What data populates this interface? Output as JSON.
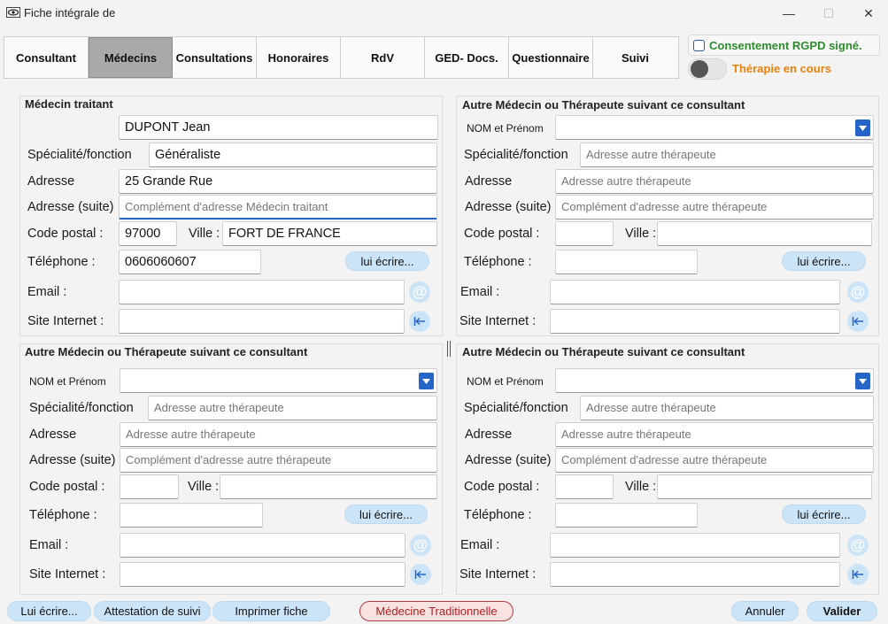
{
  "window": {
    "title": "Fiche intégrale de",
    "minimize_glyph": "—",
    "maximize_glyph": "☐",
    "close_glyph": "✕"
  },
  "tabs": [
    {
      "label": "Consultant",
      "active": false
    },
    {
      "label": "Médecins",
      "active": true
    },
    {
      "label": "Consultations",
      "active": false
    },
    {
      "label": "Honoraires",
      "active": false
    },
    {
      "label": "RdV",
      "active": false
    },
    {
      "label": "GED- Docs.",
      "active": false
    },
    {
      "label": "Questionnaire",
      "active": false
    },
    {
      "label": "Suivi",
      "active": false
    }
  ],
  "consent": {
    "label": "Consentement RGPD signé.",
    "checked": false,
    "color": "#2e8b2e"
  },
  "therapy": {
    "label": "Thérapie en cours",
    "on": false,
    "color": "#e8820c"
  },
  "treating_doctor": {
    "title": "Médecin traitant",
    "name": "DUPONT Jean",
    "specialty_label": "Spécialité/fonction",
    "specialty": "Généraliste",
    "address_label": "Adresse",
    "address": "25 Grande Rue",
    "address2_label": "Adresse (suite)",
    "address2": "",
    "address2_placeholder": "Complément d'adresse Médecin traitant",
    "postcode_label": "Code postal :",
    "postcode": "97000",
    "city_label": "Ville :",
    "city": "FORT DE FRANCE",
    "phone_label": "Téléphone :",
    "phone": "0606060607",
    "write_button": "lui écrire...",
    "email_label": "Email :",
    "email": "",
    "website_label": "Site Internet :",
    "website": ""
  },
  "other_therapist": {
    "title": "Autre Médecin ou Thérapeute suivant ce consultant",
    "name_label": "NOM et Prénom",
    "specialty_label": "Spécialité/fonction",
    "specialty_placeholder": "Adresse autre thérapeute",
    "address_label": "Adresse",
    "address_placeholder": "Adresse autre thérapeute",
    "address2_label": "Adresse (suite)",
    "address2_placeholder": "Complément d'adresse autre thérapeute",
    "postcode_label": "Code postal :",
    "city_label": "Ville :",
    "phone_label": "Téléphone :",
    "write_button": "lui écrire...",
    "email_label": "Email :",
    "website_label": "Site Internet :"
  },
  "bottom_buttons": {
    "write": "Lui écrire...",
    "attestation": "Attestation de suivi",
    "print": "Imprimer fiche",
    "traditional": "Médecine Traditionnelle",
    "cancel": "Annuler",
    "validate": "Valider"
  },
  "icons": {
    "email": "@",
    "website": "⇤"
  },
  "colors": {
    "accent": "#2465c7",
    "button_bg": "#cce4f7",
    "active_tab": "#a9a9a9"
  }
}
